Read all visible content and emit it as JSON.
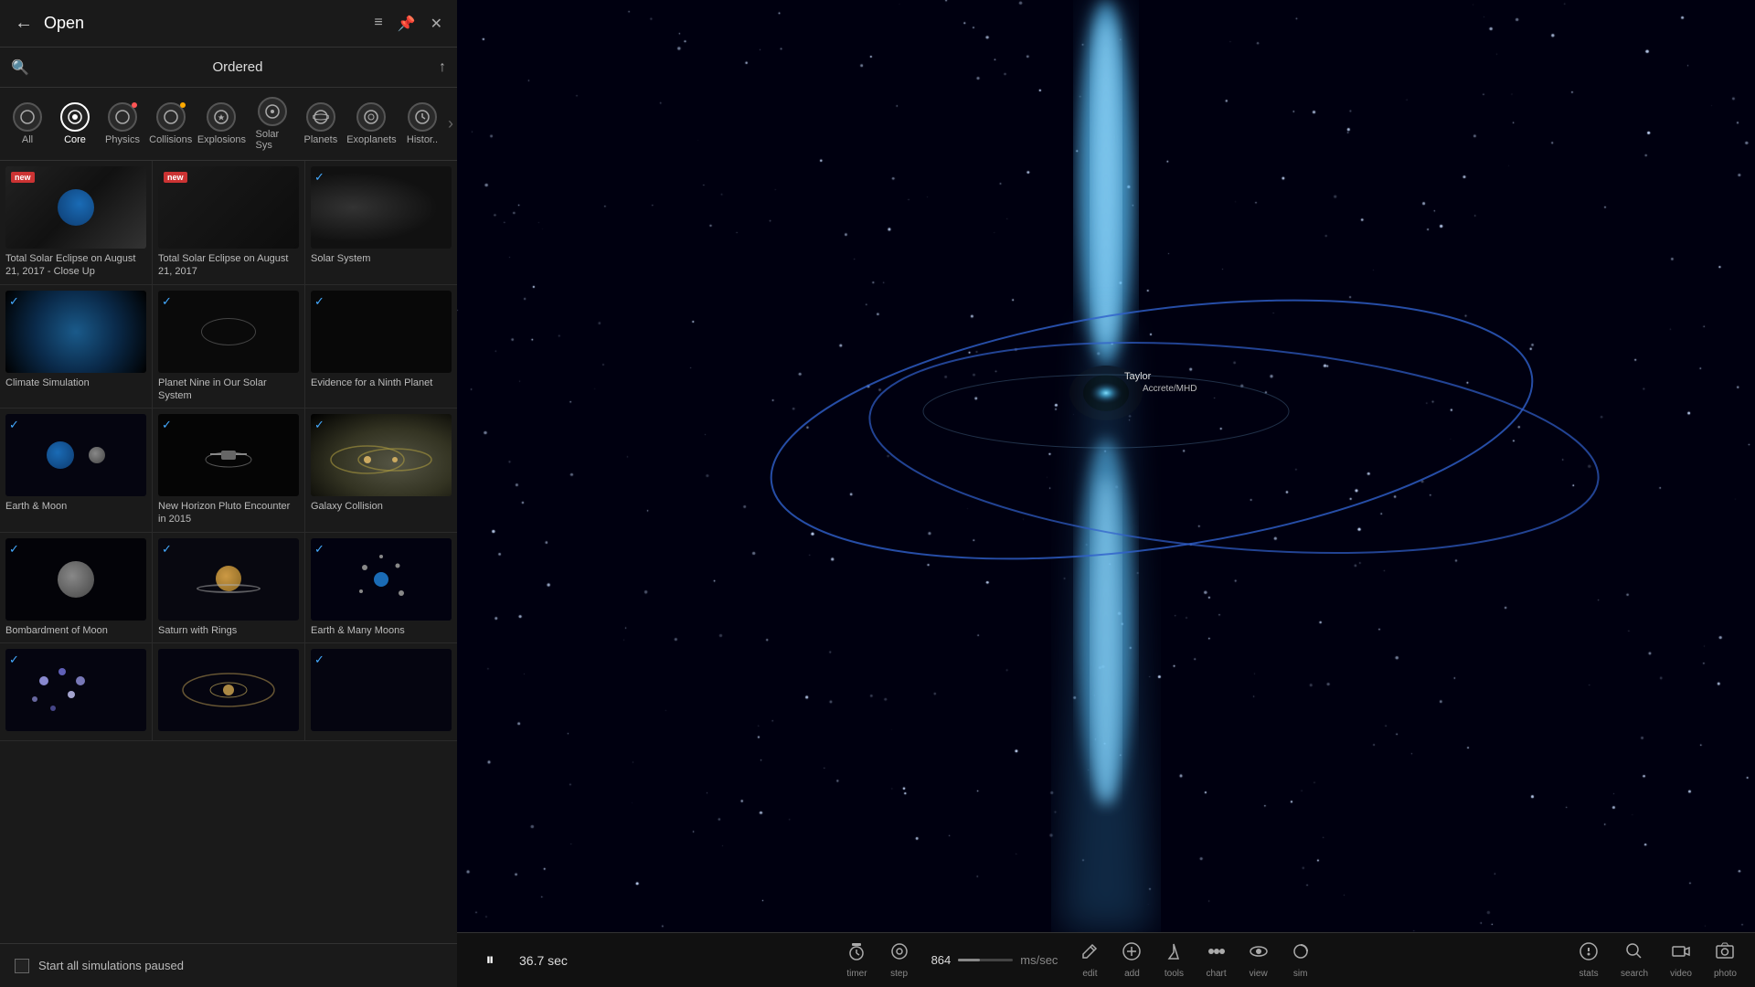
{
  "header": {
    "back_label": "←",
    "title": "Open",
    "list_icon": "≡",
    "pin_icon": "📌",
    "close_icon": "✕"
  },
  "search": {
    "icon": "🔍",
    "ordered_label": "Ordered",
    "sort_icon": "↑"
  },
  "categories": [
    {
      "id": "all",
      "label": "All",
      "active": false,
      "dot": null
    },
    {
      "id": "core",
      "label": "Core",
      "active": true,
      "dot": null
    },
    {
      "id": "physics",
      "label": "Physics",
      "active": false,
      "dot": "red"
    },
    {
      "id": "collisions",
      "label": "Collisions",
      "active": false,
      "dot": "orange"
    },
    {
      "id": "explosions",
      "label": "Explosions",
      "active": false,
      "dot": null
    },
    {
      "id": "solar-sys",
      "label": "Solar Sys",
      "active": false,
      "dot": null
    },
    {
      "id": "planets",
      "label": "Planets",
      "active": false,
      "dot": null
    },
    {
      "id": "exoplanets",
      "label": "Exoplanets",
      "active": false,
      "dot": null
    },
    {
      "id": "history",
      "label": "Histor..",
      "active": false,
      "dot": null
    }
  ],
  "simulations": [
    {
      "row": 0,
      "items": [
        {
          "id": "total-solar-eclipse-close",
          "label": "Total Solar Eclipse on August 21, 2017 - Close Up",
          "new": true,
          "checked": false,
          "type": "eclipse-close"
        },
        {
          "id": "total-solar-eclipse",
          "label": "Total Solar Eclipse on August 21, 2017",
          "new": true,
          "checked": false,
          "type": "eclipse"
        },
        {
          "id": "solar-system",
          "label": "Solar System",
          "new": false,
          "checked": true,
          "type": "solar-sys"
        }
      ]
    },
    {
      "row": 1,
      "items": [
        {
          "id": "climate-sim",
          "label": "Climate Simulation",
          "new": false,
          "checked": true,
          "type": "climate"
        },
        {
          "id": "planet-nine",
          "label": "Planet Nine in Our Solar System",
          "new": false,
          "checked": true,
          "type": "planet9"
        },
        {
          "id": "evidence-ninth",
          "label": "Evidence for a Ninth Planet",
          "new": false,
          "checked": true,
          "type": "ninth"
        }
      ]
    },
    {
      "row": 2,
      "items": [
        {
          "id": "earth-moon",
          "label": "Earth & Moon",
          "new": false,
          "checked": true,
          "type": "earth-moon"
        },
        {
          "id": "new-horizon",
          "label": "New Horizon Pluto Encounter in 2015",
          "new": false,
          "checked": true,
          "type": "new-horizon"
        },
        {
          "id": "galaxy-collision",
          "label": "Galaxy Collision",
          "new": false,
          "checked": true,
          "type": "galaxy-collision"
        }
      ]
    },
    {
      "row": 3,
      "items": [
        {
          "id": "bombardment",
          "label": "Bombardment of Moon",
          "new": false,
          "checked": true,
          "type": "bombardment"
        },
        {
          "id": "saturn-rings",
          "label": "Saturn with Rings",
          "new": false,
          "checked": true,
          "type": "saturn"
        },
        {
          "id": "many-moons",
          "label": "Earth & Many Moons",
          "new": false,
          "checked": true,
          "type": "many-moons"
        }
      ]
    },
    {
      "row": 4,
      "items": [
        {
          "id": "sim-row4-1",
          "label": "",
          "new": false,
          "checked": true,
          "type": "dark"
        },
        {
          "id": "sim-row4-2",
          "label": "",
          "new": false,
          "checked": false,
          "type": "dark2"
        },
        {
          "id": "sim-row4-3",
          "label": "",
          "new": false,
          "checked": true,
          "type": "dark3"
        }
      ]
    }
  ],
  "bottom": {
    "checkbox_label": "Start all simulations paused"
  },
  "toolbar": {
    "play_icon": "⏸",
    "time": "36.7 sec",
    "items": [
      {
        "id": "timer",
        "icon": "⏱",
        "label": "timer"
      },
      {
        "id": "step",
        "icon": "⭕",
        "label": "step"
      },
      {
        "id": "edit",
        "icon": "✋",
        "label": "edit"
      },
      {
        "id": "add",
        "icon": "➕",
        "label": "add"
      },
      {
        "id": "tools",
        "icon": "⬇",
        "label": "tools"
      },
      {
        "id": "chart",
        "icon": "⚬⚬⚬",
        "label": "chart"
      },
      {
        "id": "view",
        "icon": "👁",
        "label": "view"
      },
      {
        "id": "sim",
        "icon": "⚙",
        "label": "sim"
      }
    ],
    "speed_value": "864",
    "speed_unit": "ms/sec",
    "right_items": [
      {
        "id": "stats",
        "icon": "ℹ",
        "label": "stats"
      },
      {
        "id": "search",
        "icon": "🔍",
        "label": "search"
      },
      {
        "id": "video",
        "icon": "🎬",
        "label": "video"
      },
      {
        "id": "photo",
        "icon": "📷",
        "label": "photo"
      }
    ]
  },
  "space": {
    "taylor_label": "Taylor",
    "accent_label": "Accrete/MHD"
  }
}
